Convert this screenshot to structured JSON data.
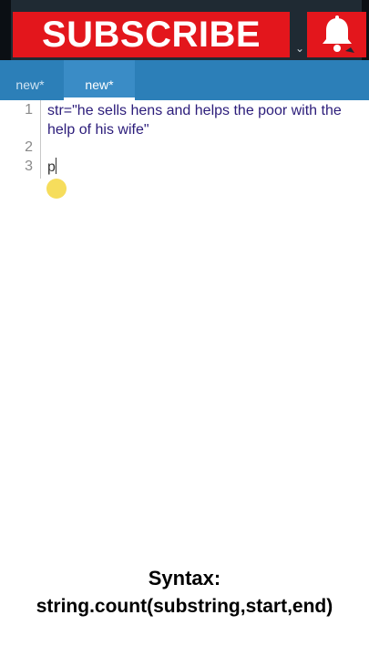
{
  "banner": {
    "subscribe_label": "SUBSCRIBE",
    "bell_icon": "bell-icon",
    "colors": {
      "banner_red": "#e3161c",
      "dark_bar": "#1f2a33"
    }
  },
  "tabs": [
    {
      "label": "new*",
      "active": false
    },
    {
      "label": "new*",
      "active": true
    }
  ],
  "tab_bar_color": "#2c7fb8",
  "editor": {
    "line_numbers": [
      "1",
      "2",
      "3"
    ],
    "lines": [
      "str=\"he sells hens and helps the poor with the",
      "help of his wife\"",
      "",
      "p"
    ],
    "code_color": "#2b1c7a"
  },
  "caption": {
    "title": "Syntax:",
    "body": "string.count(substring,start,end)"
  }
}
